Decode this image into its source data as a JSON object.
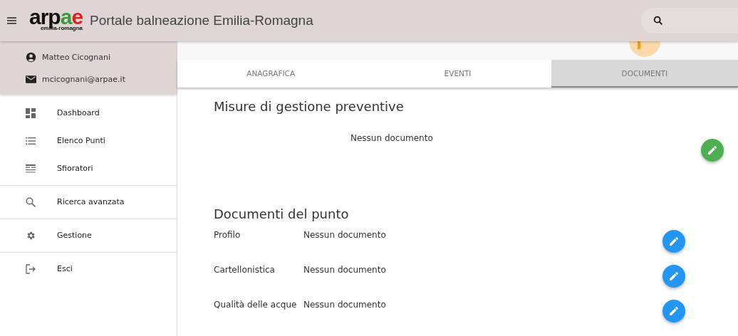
{
  "header": {
    "logo": {
      "name": "arpae",
      "subtitle": "emilia-romagna"
    },
    "title": "Portale balneazione Emilia-Romagna"
  },
  "user": {
    "name": "Matteo Cicognani",
    "email": "mcicognani@arpae.it"
  },
  "nav_groups": [
    {
      "items": [
        {
          "label": "Dashboard",
          "kind": "dashboard"
        },
        {
          "label": "Elenco Punti",
          "kind": "list"
        },
        {
          "label": "Sfioratori",
          "kind": "table"
        }
      ]
    },
    {
      "items": [
        {
          "label": "Ricerca avanzata",
          "kind": "search"
        }
      ]
    },
    {
      "items": [
        {
          "label": "Gestione",
          "kind": "settings"
        }
      ]
    },
    {
      "items": [
        {
          "label": "Esci",
          "kind": "logout"
        }
      ]
    }
  ],
  "tabs": [
    {
      "label": "ANAGRAFICA",
      "selected": false
    },
    {
      "label": "EVENTI",
      "selected": false
    },
    {
      "label": "DOCUMENTI",
      "selected": true
    }
  ],
  "preventive": {
    "heading": "Misure di gestione preventive",
    "status": "Nessun documento"
  },
  "documents": {
    "heading": "Documenti del punto",
    "rows": [
      {
        "label": "Profilo",
        "status": "Nessun documento"
      },
      {
        "label": "Cartellonistica",
        "status": "Nessun documento"
      },
      {
        "label": "Qualità delle acque",
        "status": "Nessun documento"
      }
    ]
  }
}
